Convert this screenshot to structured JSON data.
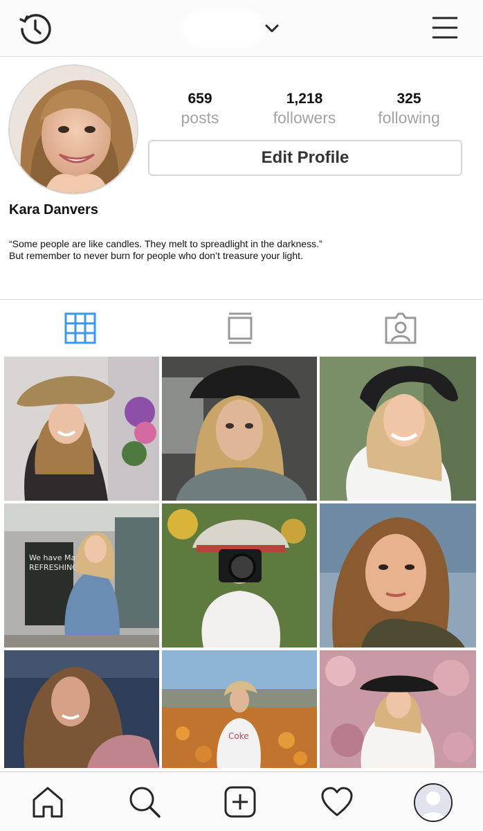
{
  "header": {
    "username": "",
    "history_icon": "history-clock-icon",
    "chevron_icon": "chevron-down-icon",
    "menu_icon": "hamburger-menu-icon"
  },
  "profile": {
    "name": "Kara Danvers",
    "bio_line1": "“Some people are like candles. They melt to spreadlight in the darkness.”",
    "bio_line2": "But remember to never burn for people who don’t treasure your light.",
    "edit_button": "Edit Profile",
    "stats": {
      "posts_count": "659",
      "posts_label": "posts",
      "followers_count": "1,218",
      "followers_label": "followers",
      "following_count": "325",
      "following_label": "following"
    }
  },
  "tabs": [
    {
      "name": "grid-view",
      "icon": "grid-icon",
      "active": true
    },
    {
      "name": "feed-view",
      "icon": "list-view-icon",
      "active": false
    },
    {
      "name": "tagged-view",
      "icon": "tagged-person-icon",
      "active": false
    }
  ],
  "colors": {
    "active_tab": "#3897f0",
    "inactive_icon": "#999999",
    "stat_label": "#a3a3a3"
  },
  "grid_photos": [
    "straw-hat-woman-with-flowers",
    "woman-in-car-hat-selfie",
    "black-hat-woman-smiling",
    "woman-at-cafe-chalkboard",
    "woman-with-camera-and-hat",
    "woman-sunset-portrait",
    "woman-evening-hair-blowing",
    "woman-in-flower-field",
    "woman-black-hat-pink-flowers"
  ],
  "bottom_nav": [
    {
      "name": "home",
      "icon": "home-icon"
    },
    {
      "name": "search",
      "icon": "search-icon"
    },
    {
      "name": "new-post",
      "icon": "add-post-icon"
    },
    {
      "name": "activity",
      "icon": "heart-icon"
    },
    {
      "name": "profile",
      "icon": "profile-avatar-icon"
    }
  ]
}
